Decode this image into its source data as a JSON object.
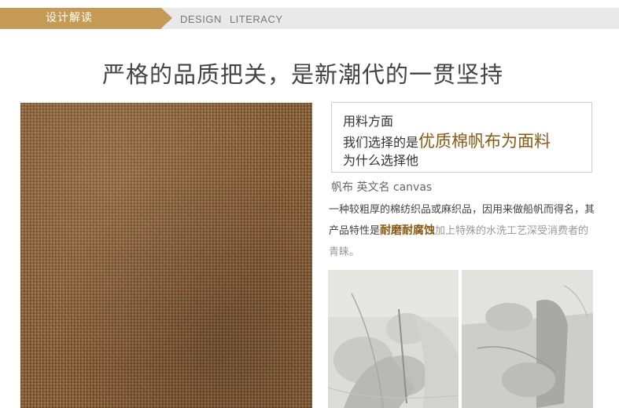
{
  "header": {
    "tab_label": "设计解读",
    "en_label": "DESIGN  LITERACY"
  },
  "title": "严格的品质把关，是新潮代的一贯坚持",
  "info_box": {
    "line1": "用料方面",
    "line2_prefix": "我们选择的是",
    "line2_highlight": "优质棉帆布为面料",
    "line3": "为什么选择他"
  },
  "canvas_name": "帆布 英文名 canvas",
  "description": {
    "part1": "一种较粗厚的棉纺织品或麻织品，因用来做船帆而得名，其产品特性是",
    "highlight": "耐磨耐腐蚀",
    "part2": "加上特殊的水洗工艺深受消费者的青睐。"
  },
  "colors": {
    "accent": "#c49a55",
    "highlight_text": "#8a5a12",
    "fabric": "#8a5e36"
  },
  "icons": {
    "photo_1": "sewing-hands-photo",
    "photo_2": "cutting-fabric-photo"
  }
}
